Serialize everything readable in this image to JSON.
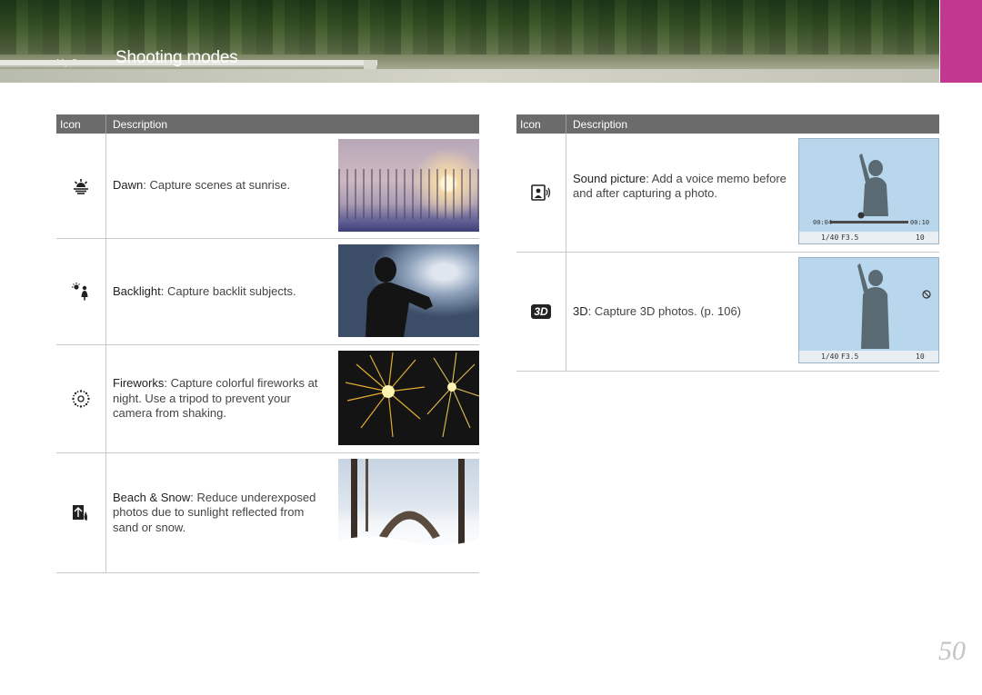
{
  "header": {
    "breadcrumb": "My Camera",
    "title": "Shooting modes",
    "accent_color": "#c0388f"
  },
  "table_left": {
    "col_icon": "Icon",
    "col_desc": "Description",
    "rows": [
      {
        "icon": "dawn-icon",
        "term": "Dawn",
        "text": ": Capture scenes at sunrise."
      },
      {
        "icon": "backlight-icon",
        "term": "Backlight",
        "text": ": Capture backlit subjects."
      },
      {
        "icon": "fireworks-icon",
        "term": "Fireworks",
        "text": ": Capture colorful fireworks at night. Use a tripod to prevent your camera from shaking."
      },
      {
        "icon": "beach-snow-icon",
        "term": "Beach & Snow",
        "text": ": Reduce underexposed photos due to sunlight reflected from sand or snow."
      }
    ]
  },
  "table_right": {
    "col_icon": "Icon",
    "col_desc": "Description",
    "rows": [
      {
        "icon": "sound-picture-icon",
        "term": "Sound picture",
        "text": ": Add a voice memo before and after capturing a photo.",
        "screen": {
          "time_start": "00:04",
          "time_end": "00:10",
          "shutter": "1/40",
          "aperture": "F3.5",
          "shots": "10"
        }
      },
      {
        "icon": "3d-icon",
        "icon_label": "3D",
        "term": "3D",
        "text": ": Capture 3D photos. (p. 106)",
        "screen": {
          "shutter": "1/40",
          "aperture": "F3.5",
          "shots": "10"
        }
      }
    ]
  },
  "page_number": "50"
}
